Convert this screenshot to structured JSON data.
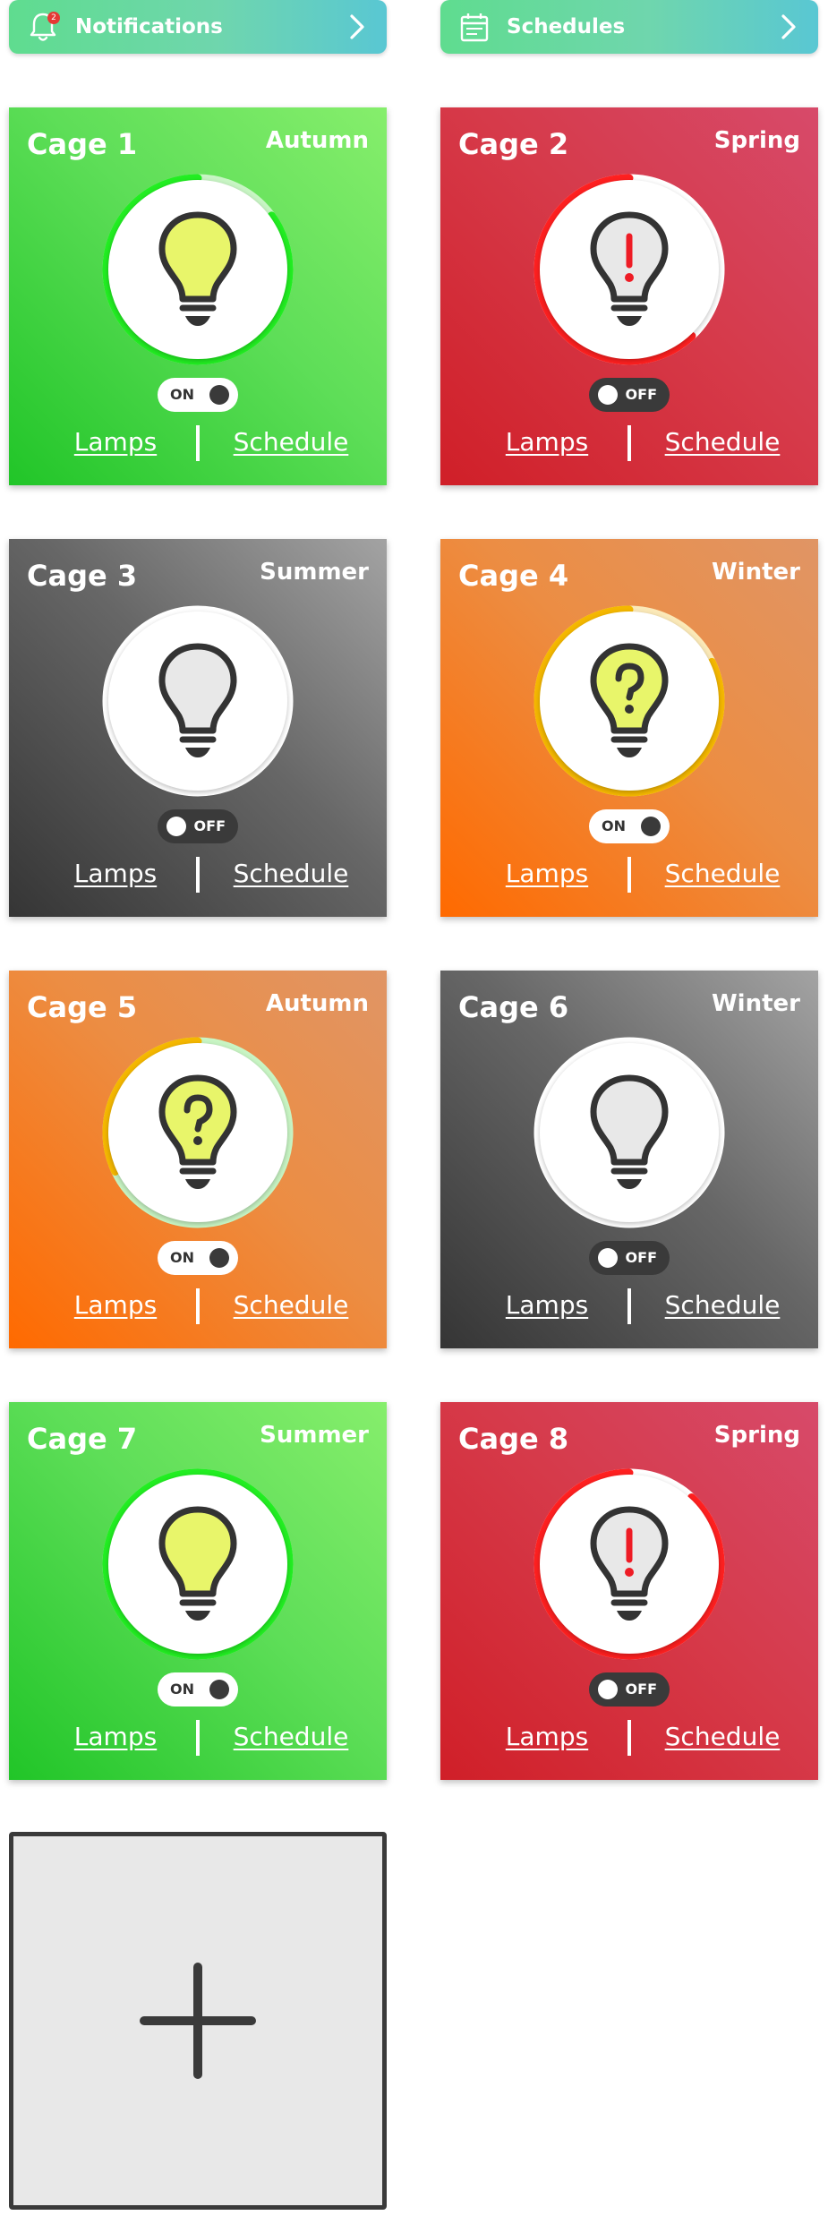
{
  "topbar": {
    "notifications": {
      "label": "Notifications",
      "badge_count": "2",
      "icon": "bell-icon"
    },
    "schedules": {
      "label": "Schedules",
      "icon": "calendar-icon"
    }
  },
  "colors": {
    "on_ring": "#22ee22",
    "alert_ring": "#ff2020",
    "warn_ring": "#f5b800",
    "bulb_lit": "#e8f56a",
    "bulb_unlit": "#e8e8e8",
    "bulb_outline": "#333333"
  },
  "cages": [
    {
      "name": "Cage 1",
      "season": "Autumn",
      "state": "on",
      "toggle_label": "ON",
      "status": "on",
      "bulb_symbol": "",
      "ring_progress": 0.85,
      "ring_color": "#22ee22",
      "ring_track": "#c8f5c4",
      "theme": "green",
      "lamps_label": "Lamps",
      "schedule_label": "Schedule"
    },
    {
      "name": "Cage 2",
      "season": "Spring",
      "state": "off",
      "toggle_label": "OFF",
      "status": "alert",
      "bulb_symbol": "!",
      "ring_progress": 0.62,
      "ring_color": "#ff2020",
      "ring_track": "#ffffff",
      "theme": "red",
      "lamps_label": "Lamps",
      "schedule_label": "Schedule"
    },
    {
      "name": "Cage 3",
      "season": "Summer",
      "state": "off",
      "toggle_label": "OFF",
      "status": "off",
      "bulb_symbol": "",
      "ring_progress": 0,
      "ring_color": "#ffffff",
      "ring_track": "#ffffff",
      "theme": "grey",
      "lamps_label": "Lamps",
      "schedule_label": "Schedule"
    },
    {
      "name": "Cage 4",
      "season": "Winter",
      "state": "on",
      "toggle_label": "ON",
      "status": "unknown",
      "bulb_symbol": "?",
      "ring_progress": 0.82,
      "ring_color": "#f5b800",
      "ring_track": "#fbe9b8",
      "theme": "orange",
      "lamps_label": "Lamps",
      "schedule_label": "Schedule"
    },
    {
      "name": "Cage 5",
      "season": "Autumn",
      "state": "on",
      "toggle_label": "ON",
      "status": "unknown",
      "bulb_symbol": "?",
      "ring_progress": 0.32,
      "ring_color": "#f5b800",
      "ring_track": "#c8f5c4",
      "theme": "orange",
      "lamps_label": "Lamps",
      "schedule_label": "Schedule"
    },
    {
      "name": "Cage 6",
      "season": "Winter",
      "state": "off",
      "toggle_label": "OFF",
      "status": "off",
      "bulb_symbol": "",
      "ring_progress": 0,
      "ring_color": "#ffffff",
      "ring_track": "#ffffff",
      "theme": "grey",
      "lamps_label": "Lamps",
      "schedule_label": "Schedule"
    },
    {
      "name": "Cage 7",
      "season": "Summer",
      "state": "on",
      "toggle_label": "ON",
      "status": "on",
      "bulb_symbol": "",
      "ring_progress": 1.0,
      "ring_color": "#22ee22",
      "ring_track": "#c8f5c4",
      "theme": "green",
      "lamps_label": "Lamps",
      "schedule_label": "Schedule"
    },
    {
      "name": "Cage 8",
      "season": "Spring",
      "state": "off",
      "toggle_label": "OFF",
      "status": "alert",
      "bulb_symbol": "!",
      "ring_progress": 0.88,
      "ring_color": "#ff2020",
      "ring_track": "#ffffff",
      "theme": "red",
      "lamps_label": "Lamps",
      "schedule_label": "Schedule"
    }
  ],
  "add_card": {
    "icon": "plus-icon"
  }
}
